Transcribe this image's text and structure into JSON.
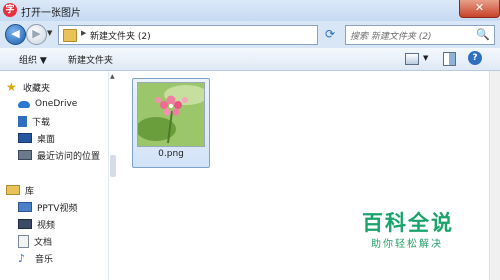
{
  "window": {
    "title": "打开一张图片",
    "close_glyph": "✕",
    "app_icon_glyph": "字"
  },
  "address": {
    "path": "新建文件夹 (2)",
    "search_placeholder": "搜索 新建文件夹 (2)"
  },
  "toolbar": {
    "organize": "组织 ▼",
    "new_folder": "新建文件夹"
  },
  "nav": {
    "favorites_label": "收藏夹",
    "onedrive_label": "OneDrive",
    "downloads_label": "下载",
    "desktop_label": "桌面",
    "recent_label": "最近访问的位置",
    "library_label": "库",
    "pptv_label": "PPTV视频",
    "videos_label": "视频",
    "documents_label": "文档",
    "music_label": "音乐"
  },
  "files": [
    {
      "name": "0.png"
    }
  ],
  "watermark": {
    "title": "百科全说",
    "subtitle": "助你轻松解决"
  },
  "colors": {
    "accent": "#2f6fc0",
    "watermark": "#1aa36a",
    "titlebar": "#c5daf3"
  }
}
